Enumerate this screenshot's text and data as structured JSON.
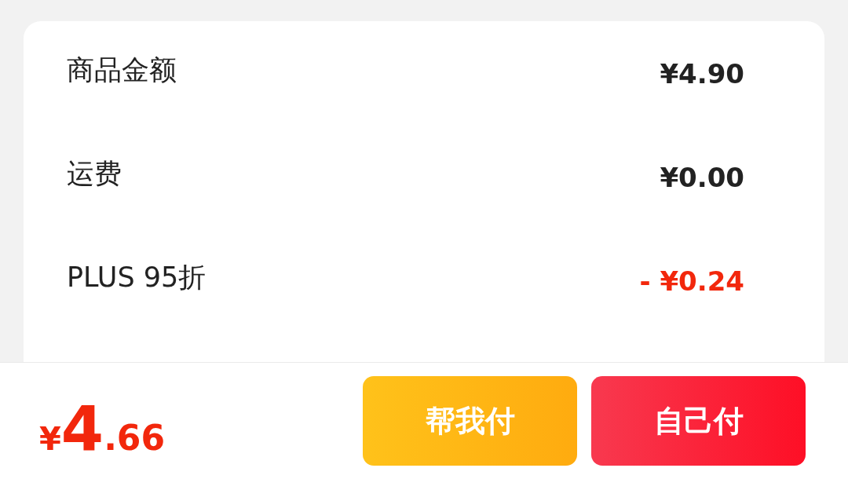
{
  "summary": {
    "rows": [
      {
        "label": "商品金额",
        "value": "¥4.90",
        "kind": "charge"
      },
      {
        "label": "运费",
        "value": "¥0.00",
        "kind": "charge"
      },
      {
        "label": "PLUS 95折",
        "value": "- ¥0.24",
        "kind": "discount"
      }
    ]
  },
  "footer": {
    "total": {
      "currency": "¥",
      "integer": "4",
      "fraction": ".66"
    },
    "buttons": [
      {
        "label": "帮我付",
        "kind": "friend"
      },
      {
        "label": "自己付",
        "kind": "self"
      }
    ]
  }
}
